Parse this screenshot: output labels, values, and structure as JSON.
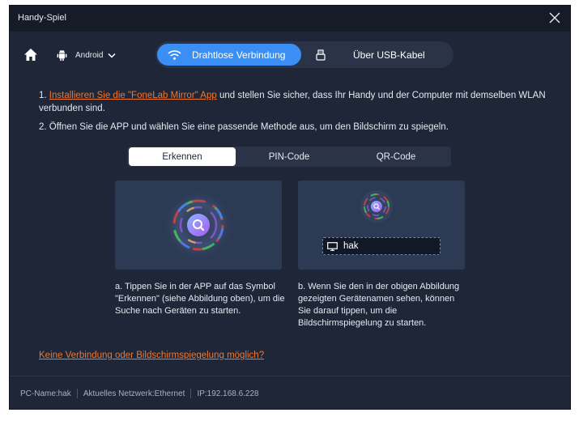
{
  "window": {
    "title": "Handy-Spiel"
  },
  "icons": {
    "close": "close-icon",
    "home": "home-icon",
    "android": "android-icon",
    "wifi": "wifi-icon",
    "usb": "usb-icon",
    "monitor": "monitor-icon"
  },
  "topbar": {
    "device_label": "Android",
    "connection_tabs": [
      {
        "label": "Drahtlose Verbindung",
        "active": true
      },
      {
        "label": "Über USB-Kabel",
        "active": false
      }
    ]
  },
  "instructions": {
    "step1_prefix": "1. ",
    "step1_link": "Installieren Sie die \"FoneLab Mirror\" App",
    "step1_rest": " und stellen Sie sicher, dass Ihr Handy und der Computer mit demselben WLAN verbunden sind.",
    "step2": "2. Öffnen Sie die APP und wählen Sie eine passende Methode aus, um den Bildschirm zu spiegeln."
  },
  "method_tabs": [
    {
      "label": "Erkennen",
      "active": true
    },
    {
      "label": "PIN-Code",
      "active": false
    },
    {
      "label": "QR-Code",
      "active": false
    }
  ],
  "cards": {
    "device_name": "hak",
    "desc_left": "a. Tippen Sie in der APP auf das Symbol \"Erkennen\" (siehe Abbildung oben), um die Suche nach Geräten zu starten.",
    "desc_right": "b. Wenn Sie den in der obigen Abbildung gezeigten Gerätenamen sehen, können Sie darauf tippen, um die Bildschirmspiegelung zu starten."
  },
  "help_link": "Keine Verbindung oder Bildschirmspiegelung möglich?",
  "footer": {
    "pc_name": "PC-Name:hak",
    "network": "Aktuelles Netzwerk:Ethernet",
    "ip": "IP:192.168.6.228"
  },
  "colors": {
    "accent": "#3b8ef3",
    "link": "#f0772f",
    "background": "#1e2637",
    "card": "#2c3a54"
  }
}
